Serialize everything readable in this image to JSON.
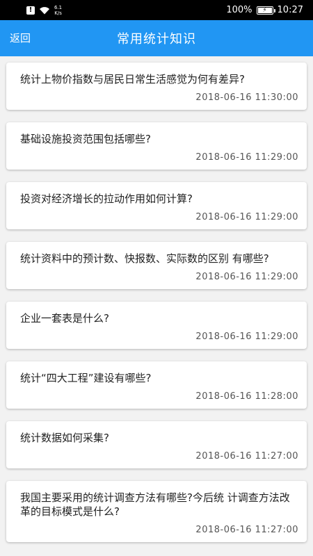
{
  "status_bar": {
    "net_speed_value": "6.1",
    "net_speed_unit": "K/s",
    "battery_percent": "100%",
    "battery_level": 1.0,
    "time": "10:27"
  },
  "header": {
    "back_label": "返回",
    "title": "常用统计知识",
    "background_color": "#2196f3"
  },
  "articles": [
    {
      "title": "统计上物价指数与居民日常生活感觉为何有差异?",
      "time": "2018-06-16 11:30:00"
    },
    {
      "title": "基础设施投资范围包括哪些?",
      "time": "2018-06-16 11:29:00"
    },
    {
      "title": "投资对经济增长的拉动作用如何计算?",
      "time": "2018-06-16 11:29:00"
    },
    {
      "title": "统计资料中的预计数、快报数、实际数的区别 有哪些?",
      "time": "2018-06-16 11:29:00"
    },
    {
      "title": "企业一套表是什么?",
      "time": "2018-06-16 11:29:00"
    },
    {
      "title": "统计“四大工程”建设有哪些?",
      "time": "2018-06-16 11:28:00"
    },
    {
      "title": "统计数据如何采集?",
      "time": "2018-06-16 11:27:00"
    },
    {
      "title": "我国主要采用的统计调查方法有哪些?今后统 计调查方法改革的目标模式是什么?",
      "time": "2018-06-16 11:27:00"
    }
  ]
}
